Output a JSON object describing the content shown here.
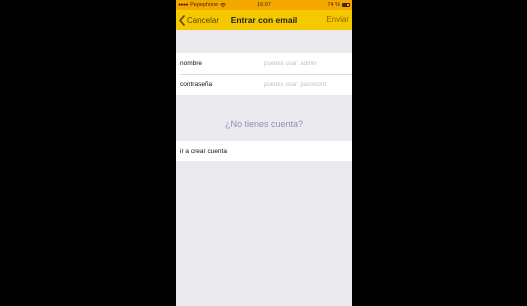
{
  "status_bar": {
    "carrier": "Pepephone",
    "time": "16:07",
    "battery": "74 %",
    "battery_level": 0.74
  },
  "nav": {
    "back_label": "Cancelar",
    "title": "Entrar con email",
    "send_label": "Enviar"
  },
  "form": {
    "username": {
      "label": "nombre",
      "value": "",
      "placeholder": "puedes usar: admin"
    },
    "password": {
      "label": "contraseña",
      "value": "",
      "placeholder": "puedes usar: password"
    }
  },
  "signup": {
    "header": "¿No tienes cuenta?",
    "link_label": "ir a crear cuenta"
  },
  "colors": {
    "status_bar": "#f5a800",
    "nav_bar": "#f5c800",
    "background": "#e9e9ee",
    "section_header": "#8b95ad"
  },
  "icons": {
    "back": "chevron-left-icon",
    "wifi": "wifi-icon",
    "battery": "battery-icon"
  }
}
